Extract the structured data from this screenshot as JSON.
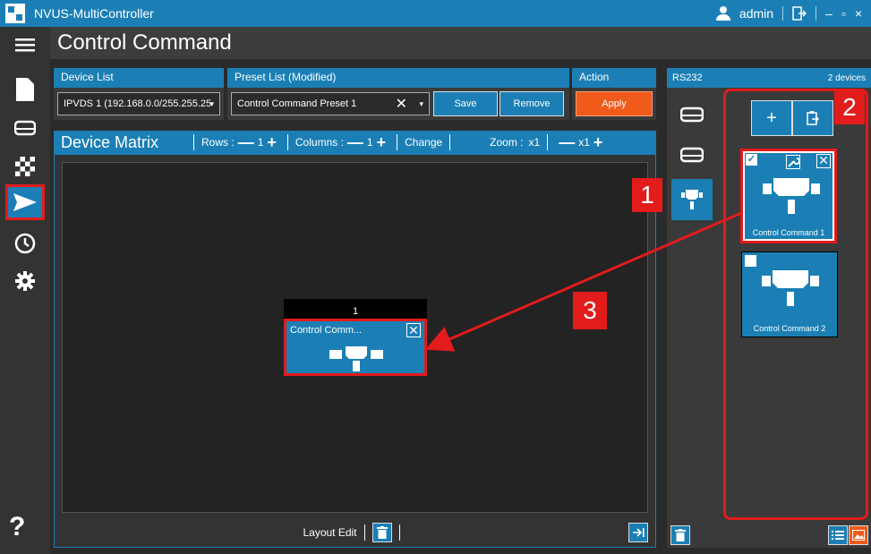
{
  "app": {
    "title": "NVUS-MultiController",
    "user": "admin"
  },
  "titlebar": {
    "minimize": "–",
    "maximize": "▫",
    "close": "×"
  },
  "sidebar": {
    "help": "?"
  },
  "page": {
    "title": "Control Command"
  },
  "device_list": {
    "label": "Device List",
    "value": "IPVDS 1 (192.168.0.0/255.255.25"
  },
  "preset_list": {
    "label": "Preset List (Modified)",
    "value": "Control Command Preset 1",
    "save": "Save",
    "remove": "Remove"
  },
  "action": {
    "label": "Action",
    "apply": "Apply"
  },
  "matrix": {
    "title": "Device Matrix",
    "rows_label": "Rows :",
    "rows_value": "1",
    "columns_label": "Columns :",
    "columns_value": "1",
    "change": "Change",
    "zoom_label": "Zoom :",
    "zoom_value": "x1",
    "zoom_value2": "x1",
    "minus": "—",
    "plus": "+",
    "cell_header": "1",
    "cell_label": "Control Comm..."
  },
  "layout_edit": "Layout Edit",
  "rs232": {
    "title": "RS232",
    "count": "2 devices",
    "devices": [
      {
        "name": "Control Command 1",
        "checked": true
      },
      {
        "name": "Control Command 2",
        "checked": false
      }
    ]
  },
  "callouts": [
    "1",
    "2",
    "3"
  ],
  "colors": {
    "accent": "#1b7fb5",
    "orange": "#f05a1a",
    "highlight": "#e21b1b"
  }
}
